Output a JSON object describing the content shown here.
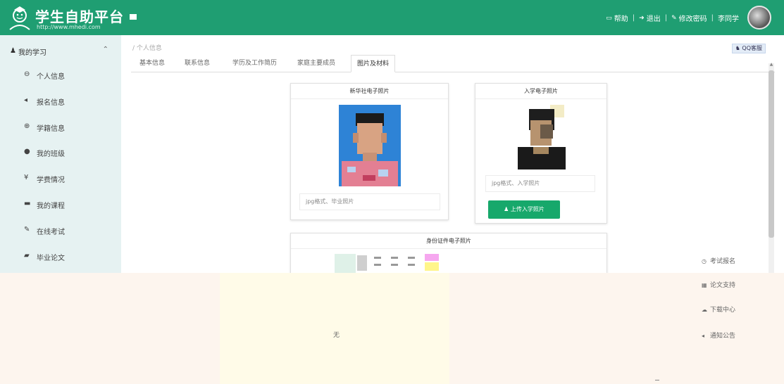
{
  "header": {
    "title": "学生自助平台",
    "url": "http://www.mhedi.com",
    "links": [
      "帮助",
      "退出",
      "修改密码",
      "李同学"
    ]
  },
  "sidebar": {
    "section": "我的学习",
    "items": [
      {
        "icon": "user-icon",
        "label": "个人信息"
      },
      {
        "icon": "megaphone-icon",
        "label": "报名信息"
      },
      {
        "icon": "globe-icon",
        "label": "学籍信息"
      },
      {
        "icon": "circle-icon",
        "label": "我的班级"
      },
      {
        "icon": "yen-icon",
        "label": "学费情况"
      },
      {
        "icon": "book-icon",
        "label": "我的课程"
      },
      {
        "icon": "pencil-icon",
        "label": "在线考试"
      },
      {
        "icon": "paper-icon",
        "label": "毕业论文"
      }
    ]
  },
  "content": {
    "breadcrumb": "/ 个人信息",
    "qq_button": "QQ客服",
    "tabs": [
      "基本信息",
      "联系信息",
      "学历及工作简历",
      "家庭主要成员",
      "图片及材料"
    ],
    "active_tab": 4,
    "graduation_photo": {
      "title": "新华社电子照片",
      "placeholder": "jpg格式、毕业照片"
    },
    "enrollment_photo": {
      "title": "入学电子照片",
      "placeholder": "jpg格式、入学照片",
      "upload_button": "上传入学照片"
    },
    "id_photo": {
      "title": "身份证件电子照片"
    }
  },
  "overlay": {
    "empty_text": "无",
    "quick_links": [
      {
        "icon": "clock-icon",
        "label": "考试报名"
      },
      {
        "icon": "grid-icon",
        "label": "论文支持"
      },
      {
        "icon": "cloud-download-icon",
        "label": "下载中心"
      },
      {
        "icon": "megaphone-icon",
        "label": "通知公告"
      }
    ]
  },
  "colors": {
    "brand": "#1f9e72",
    "button": "#17a86b",
    "sidebar_bg": "#e6f2f2"
  }
}
